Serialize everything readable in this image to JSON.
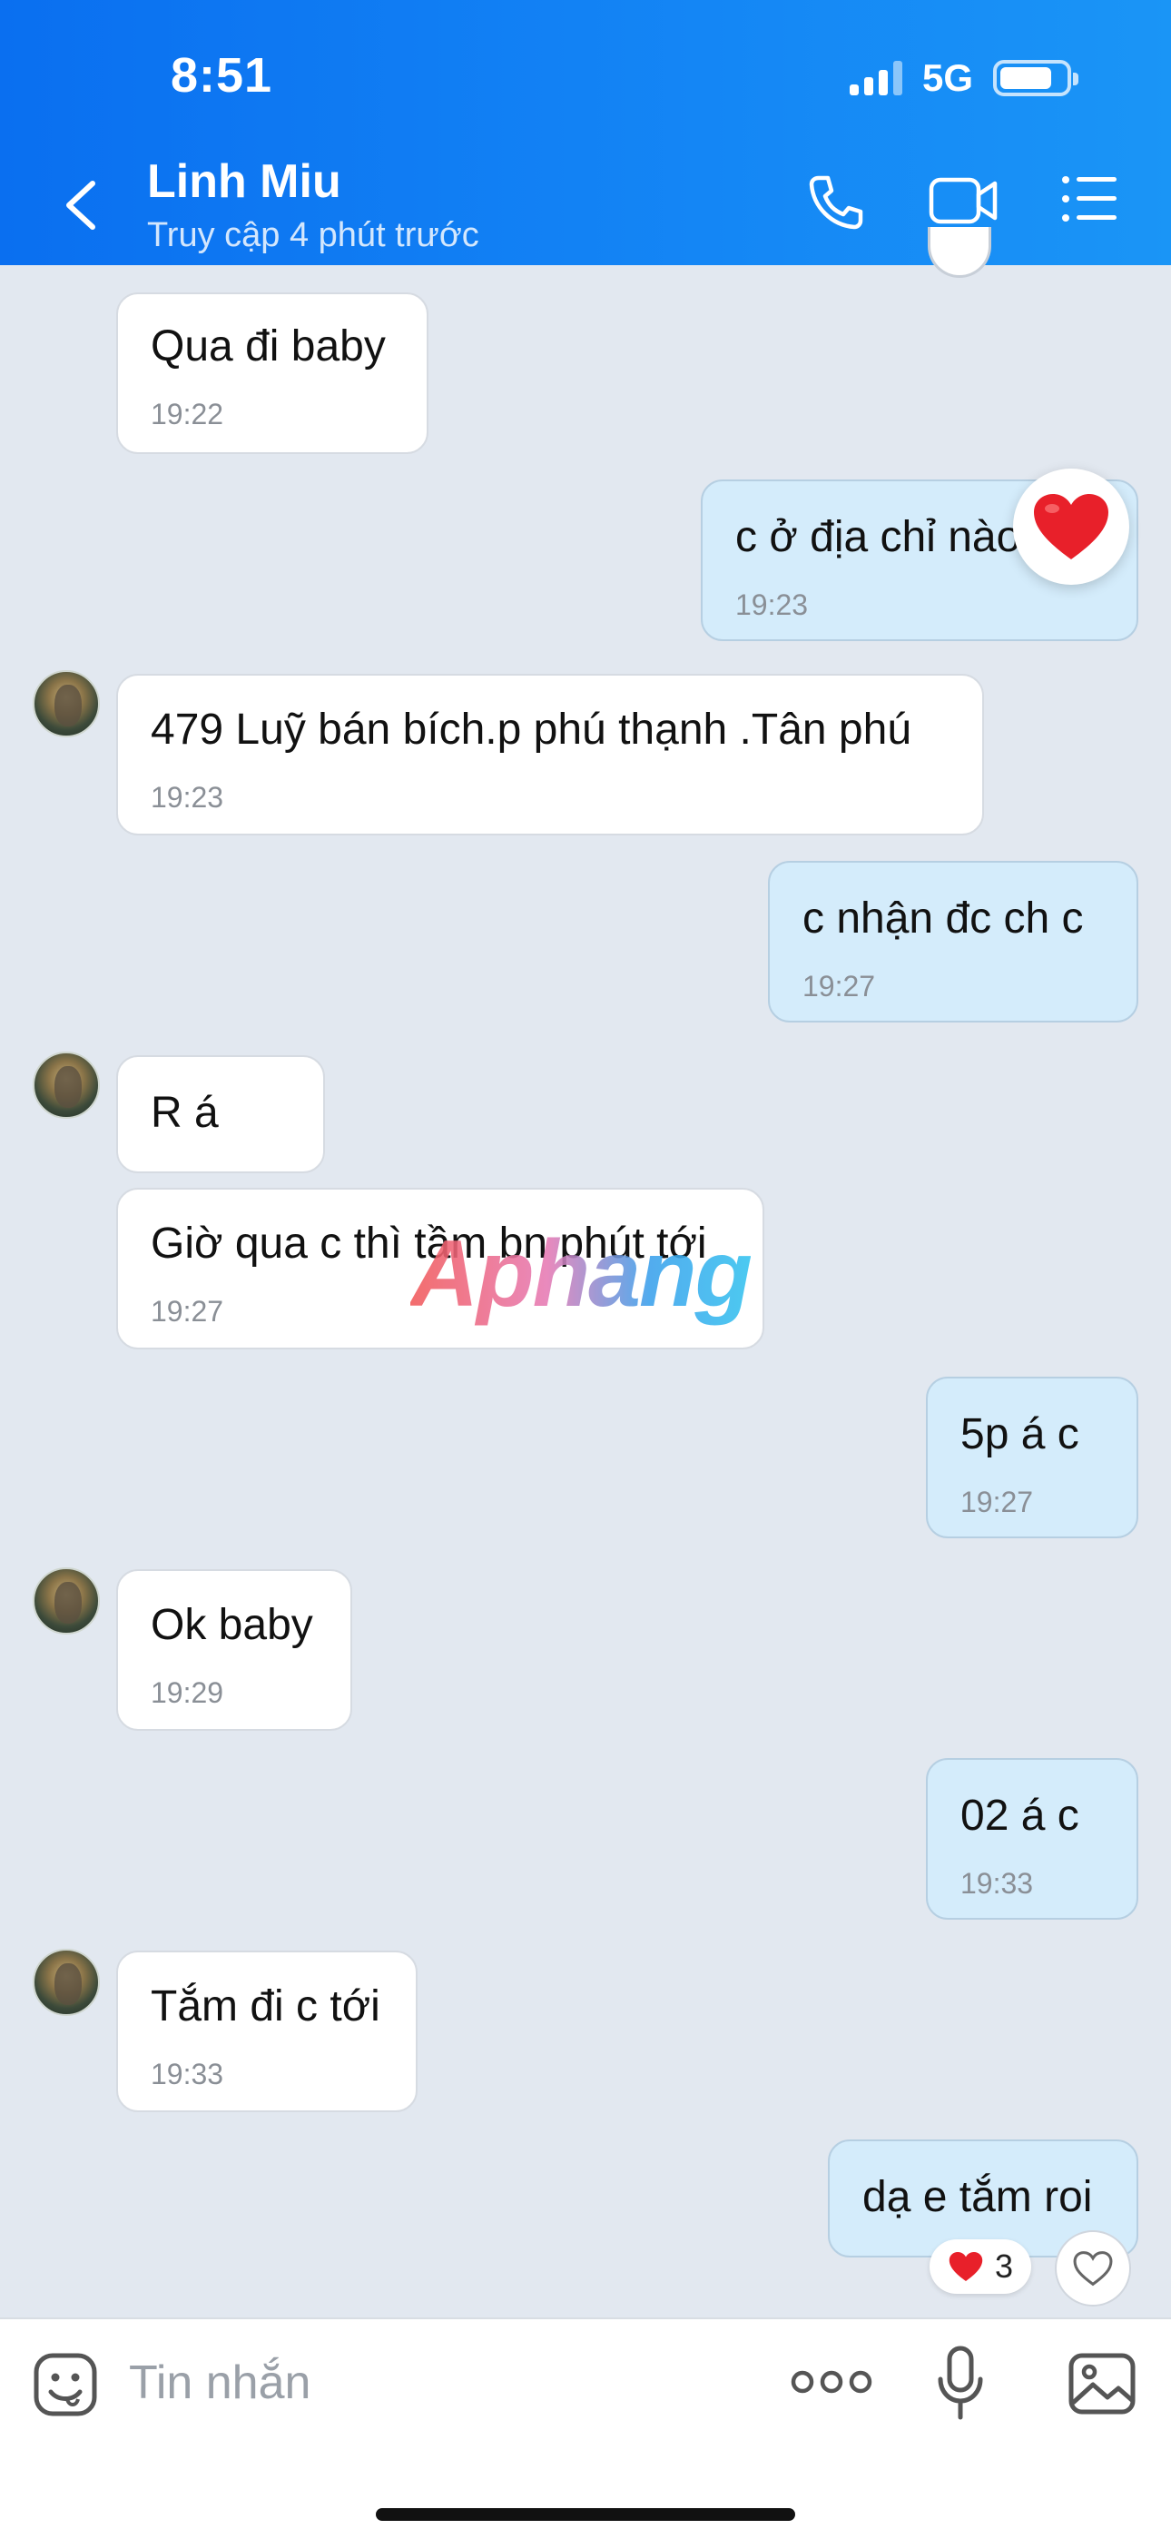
{
  "status_bar": {
    "time": "8:51",
    "network": "5G"
  },
  "header": {
    "contact_name": "Linh Miu",
    "contact_status": "Truy cập 4 phút trước"
  },
  "messages": [
    {
      "text": "Qua đi baby",
      "time": "19:22",
      "direction": "in"
    },
    {
      "text": "c ở địa chỉ nào",
      "time": "19:23",
      "direction": "out",
      "reaction": "heart"
    },
    {
      "text": "479 Luỹ bán bích.p phú thạnh .Tân phú",
      "time": "19:23",
      "direction": "in"
    },
    {
      "text": "c nhận đc ch c",
      "time": "19:27",
      "direction": "out"
    },
    {
      "text": "R á",
      "time": "",
      "direction": "in"
    },
    {
      "text": "Giờ qua c thì tầm bn phút tới",
      "time": "19:27",
      "direction": "in"
    },
    {
      "text": "5p á c",
      "time": "19:27",
      "direction": "out"
    },
    {
      "text": "Ok baby",
      "time": "19:29",
      "direction": "in"
    },
    {
      "text": "02 á c",
      "time": "19:33",
      "direction": "out"
    },
    {
      "text": "Tắm đi c tới",
      "time": "19:33",
      "direction": "in"
    },
    {
      "text": "dạ e tắm roi",
      "time": "",
      "direction": "out"
    }
  ],
  "reactions": {
    "count": "3",
    "icon": "heart"
  },
  "watermark": "Aphang",
  "composer": {
    "placeholder": "Tin nhắn"
  },
  "colors": {
    "header_blue": "#0a6ff0",
    "outgoing_bubble": "#d4ecfb",
    "incoming_bubble": "#ffffff",
    "background": "#e2e8f0",
    "heart": "#e8202a"
  }
}
